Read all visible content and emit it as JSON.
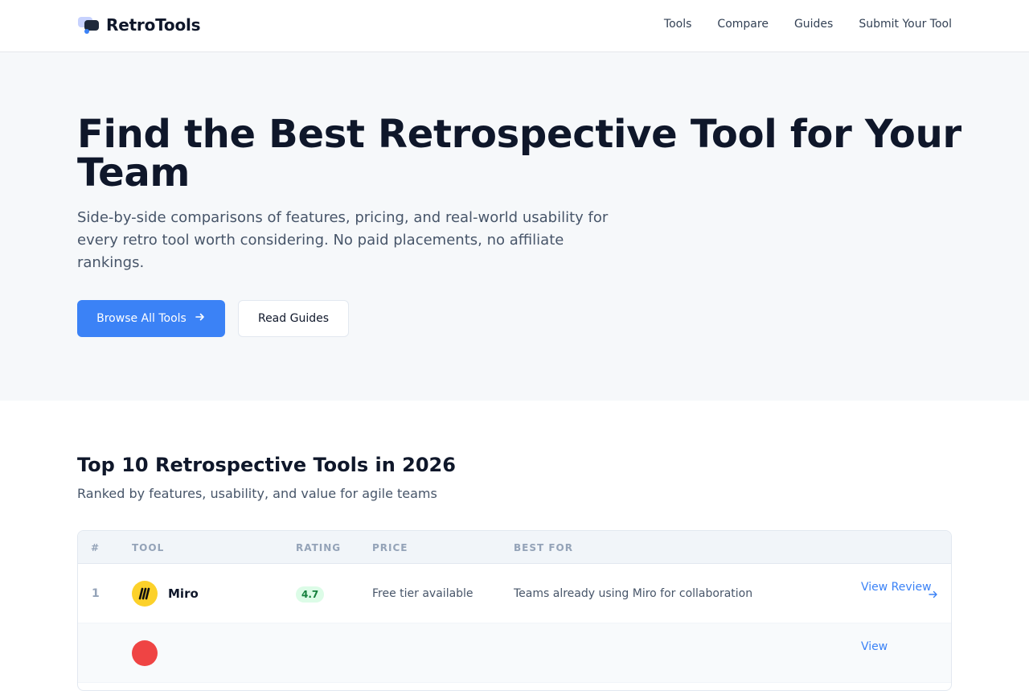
{
  "brand": {
    "name": "RetroTools"
  },
  "nav": [
    "Tools",
    "Compare",
    "Guides",
    "Submit Your Tool"
  ],
  "hero": {
    "title": "Find the Best Retrospective Tool for Your Team",
    "subtitle": "Side-by-side comparisons of features, pricing, and real-world usability for every retro tool worth considering. No paid placements, no affiliate rankings.",
    "primary_cta": "Browse All Tools",
    "secondary_cta": "Read Guides"
  },
  "ranking": {
    "title": "Top 10 Retrospective Tools in 2026",
    "subtitle": "Ranked by features, usability, and value for agile teams",
    "columns": [
      "#",
      "TOOL",
      "RATING",
      "PRICE",
      "BEST FOR"
    ],
    "rows": [
      {
        "rank": "1",
        "tool": "Miro",
        "rating": "4.7",
        "price": "Free tier available",
        "best_for": "Teams already using Miro for collaboration",
        "action": "View Review"
      }
    ],
    "next_row_action": "View"
  },
  "colors": {
    "accent": "#3b82f6",
    "rating_bg": "#dcfce7",
    "rating_text": "#15803d",
    "miro_yellow": "#fcd12a"
  },
  "icons": {
    "primary_cta": "arrow-right-icon",
    "review": "arrow-right-icon",
    "brand": "chat-bubbles-logo"
  }
}
